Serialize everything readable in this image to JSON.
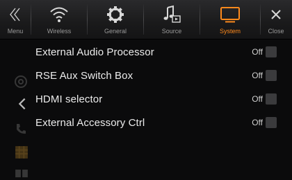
{
  "header": {
    "tabs": [
      {
        "id": "menu",
        "label": "Menu",
        "icon": "double-chevron-left-icon",
        "active": false
      },
      {
        "id": "wireless",
        "label": "Wireless",
        "icon": "wifi-icon",
        "active": false
      },
      {
        "id": "general",
        "label": "General",
        "icon": "gear-icon",
        "active": false
      },
      {
        "id": "source",
        "label": "Source",
        "icon": "music-note-icon",
        "active": false
      },
      {
        "id": "system",
        "label": "System",
        "icon": "monitor-icon",
        "active": true
      },
      {
        "id": "close",
        "label": "Close",
        "icon": "close-icon",
        "active": false
      }
    ]
  },
  "settings": {
    "items": [
      {
        "name": "External Audio Processor",
        "value": "Off"
      },
      {
        "name": "RSE Aux Switch Box",
        "value": "Off"
      },
      {
        "name": "HDMI selector",
        "value": "Off"
      },
      {
        "name": "External Accessory Ctrl",
        "value": "Off"
      }
    ]
  },
  "colors": {
    "accent": "#ff8a1c",
    "background": "#0b0b0c",
    "toggle_box": "#3b3b3d"
  }
}
